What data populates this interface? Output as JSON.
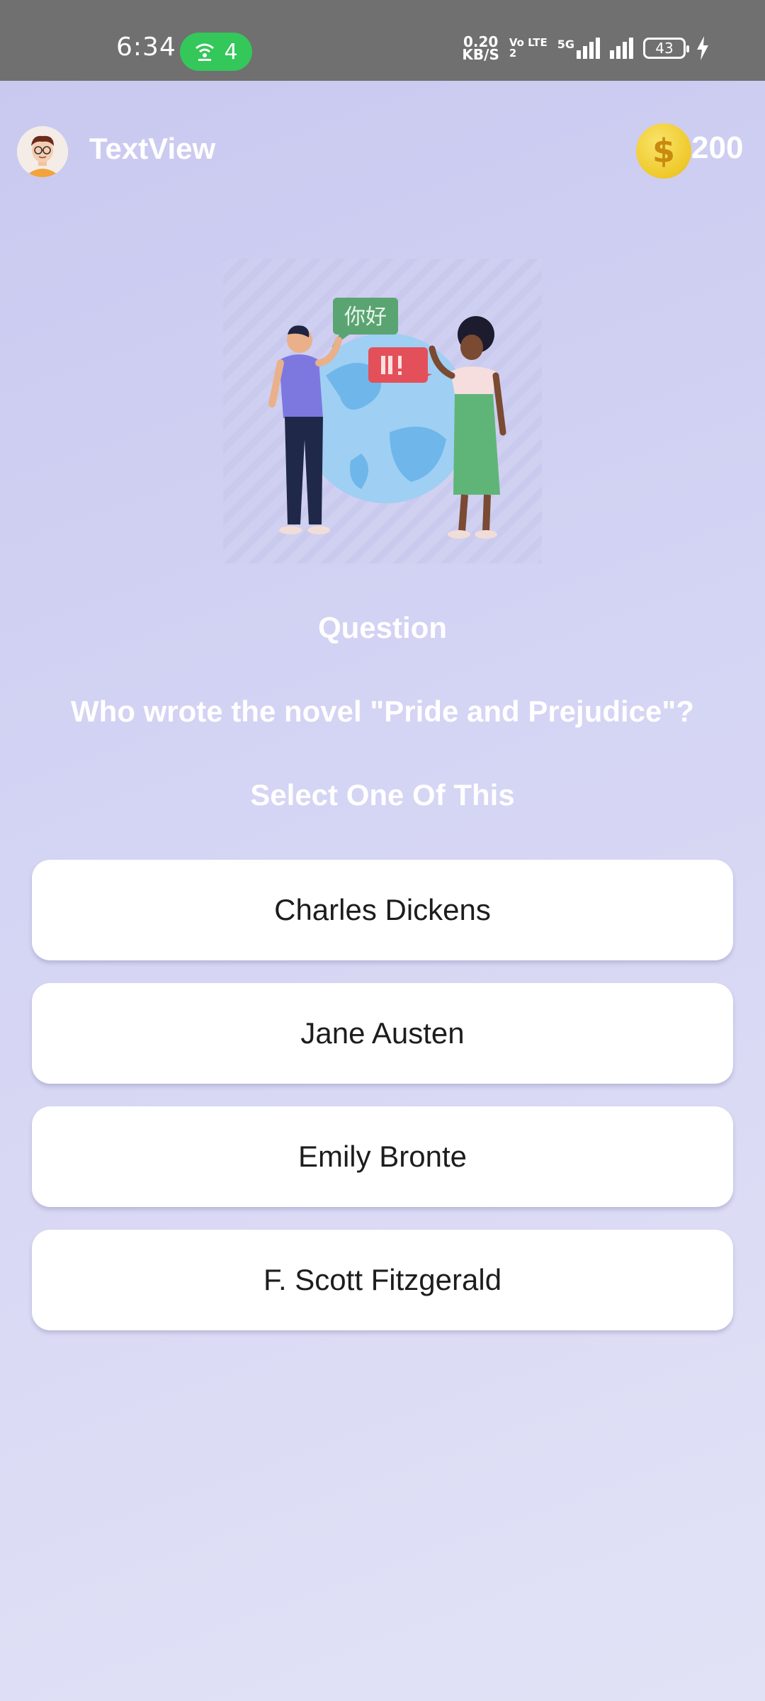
{
  "status_bar": {
    "time": "6:34",
    "hotspot_count": "4",
    "net_speed_value": "0.20",
    "net_speed_unit": "KB/S",
    "volte_top": "Vo LTE",
    "volte_bottom": "2",
    "network": "5G",
    "battery": "43"
  },
  "header": {
    "title": "TextView",
    "coins": "200",
    "coin_symbol": "$"
  },
  "quiz": {
    "label": "Question",
    "question": "Who wrote the novel \"Pride and Prejudice\"?",
    "hint": "Select One Of This",
    "options": [
      {
        "label": "Charles Dickens"
      },
      {
        "label": "Jane Austen"
      },
      {
        "label": "Emily Bronte"
      },
      {
        "label": "F. Scott Fitzgerald"
      }
    ]
  },
  "illustration": {
    "speech_bubble_left": "你好"
  },
  "colors": {
    "accent_coin": "#efc92a",
    "hotspot": "#34c759",
    "status_bar": "#707070"
  }
}
